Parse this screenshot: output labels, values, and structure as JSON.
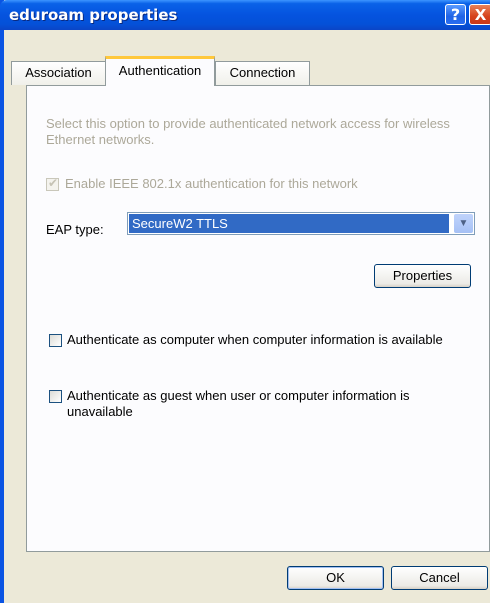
{
  "window": {
    "title": "eduroam properties"
  },
  "titlebar": {
    "help_glyph": "?",
    "close_glyph": "X"
  },
  "tabs": [
    {
      "label": "Association"
    },
    {
      "label": "Authentication"
    },
    {
      "label": "Connection"
    }
  ],
  "panel": {
    "description": "Select this option to provide authenticated network access for wireless Ethernet networks.",
    "enable_8021x": {
      "label": "Enable IEEE 802.1x authentication for this network",
      "checked": true,
      "enabled": false
    },
    "eap": {
      "label": "EAP type:",
      "value": "SecureW2 TTLS"
    },
    "properties_button": "Properties",
    "auth_computer": {
      "label": "Authenticate as computer when computer information is available",
      "checked": false
    },
    "auth_guest": {
      "label": "Authenticate as guest when user or computer information is unavailable",
      "checked": false
    }
  },
  "footer": {
    "ok_label": "OK",
    "cancel_label": "Cancel"
  },
  "colors": {
    "titlebar": "#0553df",
    "selection": "#316ac5",
    "active_tab_accent": "#ffc83c"
  }
}
